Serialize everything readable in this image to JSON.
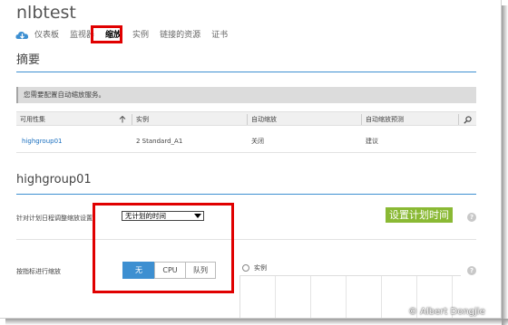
{
  "app": {
    "title": "nlbtest"
  },
  "nav": {
    "items": [
      {
        "label": "仪表板",
        "active": false
      },
      {
        "label": "监视器",
        "active": false
      },
      {
        "label": "缩放",
        "active": true
      },
      {
        "label": "实例",
        "active": false
      },
      {
        "label": "链接的资源",
        "active": false
      },
      {
        "label": "证书",
        "active": false
      }
    ]
  },
  "summary": {
    "title": "摘要",
    "banner": "您需要配置自动缩放服务。",
    "columns": [
      "可用性集",
      "实例",
      "自动缩放",
      "自动缩放预测"
    ],
    "rows": [
      {
        "availability_set": "highgroup01",
        "instances": "2 Standard_A1",
        "autoscale": "关闭",
        "prediction": "建议"
      }
    ]
  },
  "group": {
    "title": "highgroup01",
    "schedule": {
      "label": "针对计划日程调整缩放设置",
      "select_value": "无计划的时间",
      "button_label": "设置计划时间"
    },
    "scale_by": {
      "label": "按指标进行缩放",
      "options": [
        {
          "label": "无",
          "selected": true
        },
        {
          "label": "CPU",
          "selected": false
        },
        {
          "label": "队列",
          "selected": false
        }
      ],
      "instances_label": "实例"
    }
  },
  "watermark": "© Albert Dongjie",
  "colors": {
    "accent": "#3d8fd1",
    "button_green": "#8ab934",
    "highlight": "#e00000",
    "link": "#1a6fbf"
  }
}
